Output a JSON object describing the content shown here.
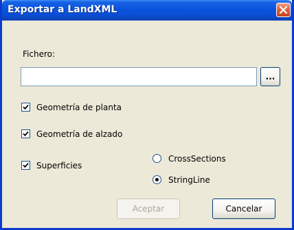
{
  "window": {
    "title": "Exportar a LandXML"
  },
  "file": {
    "label": "Fichero:",
    "value": "",
    "browse_label": "..."
  },
  "options": [
    {
      "label": "Geometría de planta",
      "checked": true
    },
    {
      "label": "Geometría de alzado",
      "checked": true
    },
    {
      "label": "Superficies",
      "checked": true
    }
  ],
  "surface_mode": {
    "choices": [
      {
        "label": "CrossSections",
        "selected": false
      },
      {
        "label": "StringLine",
        "selected": true
      }
    ]
  },
  "buttons": {
    "accept_label": "Aceptar",
    "accept_enabled": false,
    "cancel_label": "Cancelar"
  },
  "colors": {
    "titlebar": "#0a52dc",
    "close": "#e0603c",
    "face": "#ece9d8"
  },
  "icons": {
    "close": "close-icon",
    "check": "checkmark-icon",
    "radio": "radio-dot-icon"
  }
}
